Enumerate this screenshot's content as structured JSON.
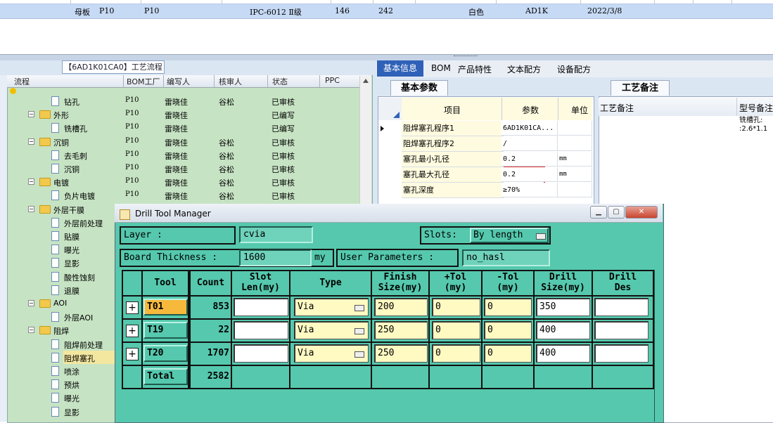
{
  "top_grid": {
    "row": [
      "母板",
      "P10",
      "P10",
      "IPC-6012 Ⅱ级",
      "146",
      "242",
      "白色",
      "AD1K",
      "2022/3/8"
    ]
  },
  "flow_panel": {
    "title": "【6AD1K01CA0】工艺流程",
    "headers": [
      "流程",
      "BOM工厂",
      "编写人",
      "核审人",
      "状态",
      "PPC"
    ],
    "rows": [
      {
        "label": "钻孔",
        "level": 2,
        "kind": "doc",
        "bom": "P10",
        "writer": "雷晓佳",
        "reviewer": "谷松",
        "status": "已审核"
      },
      {
        "label": "外形",
        "level": 1,
        "kind": "folder",
        "bom": "P10",
        "writer": "雷晓佳",
        "reviewer": "",
        "status": "已编写"
      },
      {
        "label": "铣槽孔",
        "level": 2,
        "kind": "doc",
        "bom": "P10",
        "writer": "雷晓佳",
        "reviewer": "",
        "status": "已编写"
      },
      {
        "label": "沉铜",
        "level": 1,
        "kind": "folder",
        "bom": "P10",
        "writer": "雷晓佳",
        "reviewer": "谷松",
        "status": "已审核"
      },
      {
        "label": "去毛刺",
        "level": 2,
        "kind": "doc",
        "bom": "P10",
        "writer": "雷晓佳",
        "reviewer": "谷松",
        "status": "已审核"
      },
      {
        "label": "沉铜",
        "level": 2,
        "kind": "doc",
        "bom": "P10",
        "writer": "雷晓佳",
        "reviewer": "谷松",
        "status": "已审核"
      },
      {
        "label": "电镀",
        "level": 1,
        "kind": "folder",
        "bom": "P10",
        "writer": "雷晓佳",
        "reviewer": "谷松",
        "status": "已审核"
      },
      {
        "label": "负片电镀",
        "level": 2,
        "kind": "doc",
        "bom": "P10",
        "writer": "雷晓佳",
        "reviewer": "谷松",
        "status": "已审核"
      },
      {
        "label": "外层干膜",
        "level": 1,
        "kind": "folder",
        "bom": "",
        "writer": "",
        "reviewer": "",
        "status": ""
      },
      {
        "label": "外层前处理",
        "level": 2,
        "kind": "doc",
        "bom": "",
        "writer": "",
        "reviewer": "",
        "status": ""
      },
      {
        "label": "贴膜",
        "level": 2,
        "kind": "doc",
        "bom": "",
        "writer": "",
        "reviewer": "",
        "status": ""
      },
      {
        "label": "曝光",
        "level": 2,
        "kind": "doc",
        "bom": "",
        "writer": "",
        "reviewer": "",
        "status": ""
      },
      {
        "label": "显影",
        "level": 2,
        "kind": "doc",
        "bom": "",
        "writer": "",
        "reviewer": "",
        "status": ""
      },
      {
        "label": "酸性蚀刻",
        "level": 2,
        "kind": "doc",
        "bom": "",
        "writer": "",
        "reviewer": "",
        "status": ""
      },
      {
        "label": "退膜",
        "level": 2,
        "kind": "doc",
        "bom": "",
        "writer": "",
        "reviewer": "",
        "status": ""
      },
      {
        "label": "AOI",
        "level": 1,
        "kind": "folder",
        "bom": "",
        "writer": "",
        "reviewer": "",
        "status": ""
      },
      {
        "label": "外层AOI",
        "level": 2,
        "kind": "doc",
        "bom": "",
        "writer": "",
        "reviewer": "",
        "status": ""
      },
      {
        "label": "阻焊",
        "level": 1,
        "kind": "folder",
        "bom": "",
        "writer": "",
        "reviewer": "",
        "status": ""
      },
      {
        "label": "阻焊前处理",
        "level": 2,
        "kind": "doc",
        "bom": "",
        "writer": "",
        "reviewer": "",
        "status": ""
      },
      {
        "label": "阻焊塞孔",
        "level": 2,
        "kind": "doc",
        "bom": "",
        "writer": "",
        "reviewer": "",
        "status": "",
        "selected": true
      },
      {
        "label": "喷涂",
        "level": 2,
        "kind": "doc",
        "bom": "",
        "writer": "",
        "reviewer": "",
        "status": ""
      },
      {
        "label": "预烘",
        "level": 2,
        "kind": "doc",
        "bom": "",
        "writer": "",
        "reviewer": "",
        "status": ""
      },
      {
        "label": "曝光",
        "level": 2,
        "kind": "doc",
        "bom": "",
        "writer": "",
        "reviewer": "",
        "status": ""
      },
      {
        "label": "显影",
        "level": 2,
        "kind": "doc",
        "bom": "",
        "writer": "",
        "reviewer": "",
        "status": ""
      }
    ]
  },
  "right_panel": {
    "tabs": [
      "基本信息",
      "BOM",
      "产品特性",
      "文本配方",
      "设备配方"
    ],
    "subtab_params": "基本参数",
    "subtab_memo": "工艺备注",
    "param_headers": {
      "item": "项目",
      "value": "参数",
      "unit": "单位"
    },
    "params": [
      {
        "name": "阻焊塞孔程序1",
        "value": "6AD1K01CA...",
        "unit": ""
      },
      {
        "name": "阻焊塞孔程序2",
        "value": "/",
        "unit": ""
      },
      {
        "name": "塞孔最小孔径",
        "value": "0.2",
        "unit": "mm"
      },
      {
        "name": "塞孔最大孔径",
        "value": "0.2",
        "unit": "mm"
      },
      {
        "name": "塞孔深度",
        "value": "≥70%",
        "unit": ""
      }
    ],
    "memo_headers": [
      "工艺备注",
      "型号备注"
    ],
    "memo_text": "铣槽孔:\n:2.6*1.1"
  },
  "dialog": {
    "title": "Drill Tool Manager",
    "layer_label": "Layer        :",
    "layer_value": "cvia",
    "slots_label": "Slots:",
    "slots_value": "By length",
    "thickness_label": "Board Thickness :",
    "thickness_value": "1600",
    "thickness_unit": "my",
    "user_params_label": "User Parameters :",
    "user_params_value": "no_hasl",
    "table_headers": [
      "Tool",
      "Count",
      "Slot\nLen(my)",
      "Type",
      "Finish\nSize(my)",
      "+Tol\n(my)",
      "-Tol\n(my)",
      "Drill\nSize(my)",
      "Drill\nDes"
    ],
    "tools": [
      {
        "tool": "T01",
        "count": "853",
        "type": "Via",
        "finish": "200",
        "ptol": "0",
        "ntol": "0",
        "drill": "350",
        "highlight": true
      },
      {
        "tool": "T19",
        "count": "22",
        "type": "Via",
        "finish": "250",
        "ptol": "0",
        "ntol": "0",
        "drill": "400",
        "highlight": false
      },
      {
        "tool": "T20",
        "count": "1707",
        "type": "Via",
        "finish": "250",
        "ptol": "0",
        "ntol": "0",
        "drill": "400",
        "highlight": false
      }
    ],
    "total_label": "Total",
    "total_count": "2582"
  }
}
